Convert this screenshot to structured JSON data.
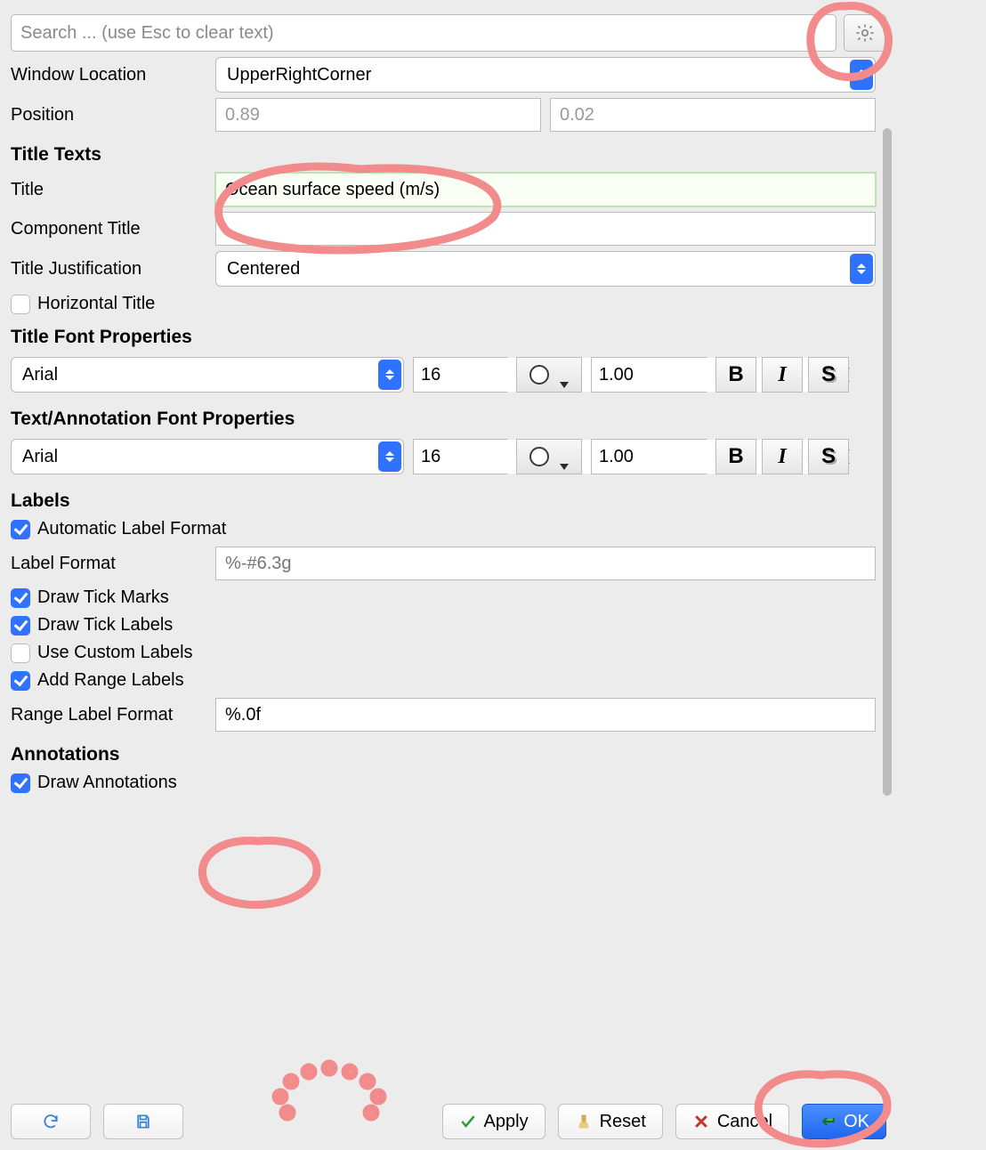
{
  "search": {
    "placeholder": "Search ... (use Esc to clear text)"
  },
  "windowLocation": {
    "label": "Window Location",
    "value": "UpperRightCorner"
  },
  "position": {
    "label": "Position",
    "x": "0.89",
    "y": "0.02"
  },
  "sections": {
    "titleTexts": "Title Texts",
    "titleFontProps": "Title Font Properties",
    "textAnnoFontProps": "Text/Annotation Font Properties",
    "labels": "Labels",
    "annotations": "Annotations"
  },
  "title": {
    "label": "Title",
    "value": "Ocean surface speed (m/s)"
  },
  "componentTitle": {
    "label": "Component Title",
    "value": ""
  },
  "titleJustification": {
    "label": "Title Justification",
    "value": "Centered"
  },
  "horizontalTitle": {
    "label": "Horizontal Title",
    "checked": false
  },
  "titleFont": {
    "family": "Arial",
    "size": "16",
    "opacity": "1.00"
  },
  "textFont": {
    "family": "Arial",
    "size": "16",
    "opacity": "1.00"
  },
  "autoLabelFormat": {
    "label": "Automatic Label Format",
    "checked": true
  },
  "labelFormat": {
    "label": "Label Format",
    "placeholder": "%-#6.3g"
  },
  "drawTickMarks": {
    "label": "Draw Tick Marks",
    "checked": true
  },
  "drawTickLabels": {
    "label": "Draw Tick Labels",
    "checked": true
  },
  "useCustomLabels": {
    "label": "Use Custom Labels",
    "checked": false
  },
  "addRangeLabels": {
    "label": "Add Range Labels",
    "checked": true
  },
  "rangeLabelFormat": {
    "label": "Range Label Format",
    "value": "%.0f"
  },
  "drawAnnotations": {
    "label": "Draw Annotations",
    "checked": true
  },
  "buttons": {
    "apply": "Apply",
    "reset": "Reset",
    "cancel": "Cancel",
    "ok": "OK"
  },
  "styleLetters": {
    "bold": "B",
    "italic": "I",
    "shadow": "S"
  }
}
